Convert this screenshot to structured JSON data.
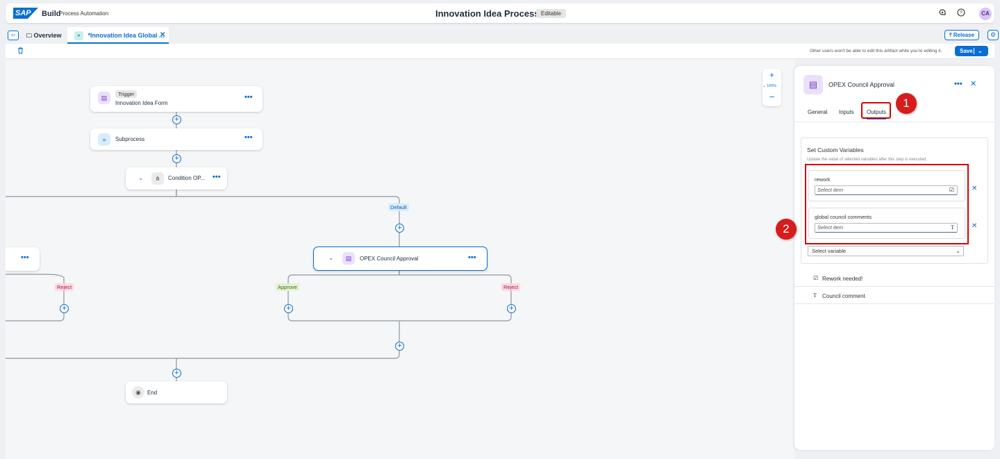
{
  "shell": {
    "logo": "SAP",
    "brand": "Build",
    "product": "Process Automation",
    "title": "Innovation Idea Process",
    "editable_badge": "Editable",
    "avatar_initials": "CA"
  },
  "tabs": {
    "overview": "Overview",
    "active": "*Innovation Idea Global ...",
    "release": "Release"
  },
  "toolbar": {
    "edit_note": "Other users won't be able to edit this artifact while you're editing it.",
    "save": "Save"
  },
  "canvas": {
    "trigger": {
      "tag": "Trigger",
      "label": "Innovation Idea Form"
    },
    "subprocess": {
      "label": "Subprocess"
    },
    "condition": {
      "label": "Condition OP..."
    },
    "default_label": "Default",
    "approval": {
      "label": "OPEX Council Approval"
    },
    "approve_label": "Approve",
    "reject_label": "Reject",
    "end": {
      "label": "End"
    },
    "zoom_level": "100%"
  },
  "panel": {
    "title": "OPEX Council Approval",
    "tabs": [
      "General",
      "Inputs",
      "Outputs"
    ],
    "active_tab": "Outputs",
    "section_title": "Set Custom Variables",
    "section_subtitle": "Update the value of selected variables after this step is executed.",
    "variables": [
      {
        "label": "rework",
        "placeholder": "Select item",
        "type_icon": "checkbox-icon"
      },
      {
        "label": "global council comments",
        "placeholder": "Select item",
        "type_icon": "text-icon"
      }
    ],
    "select_variable": "Select variable",
    "list": [
      {
        "label": "Rework needed!",
        "icon": "checkbox-icon"
      },
      {
        "label": "Council comment",
        "icon": "text-icon"
      }
    ]
  },
  "annotations": {
    "one": "1",
    "two": "2"
  },
  "colors": {
    "accent": "#0a6ed1",
    "callout": "#d40000"
  }
}
